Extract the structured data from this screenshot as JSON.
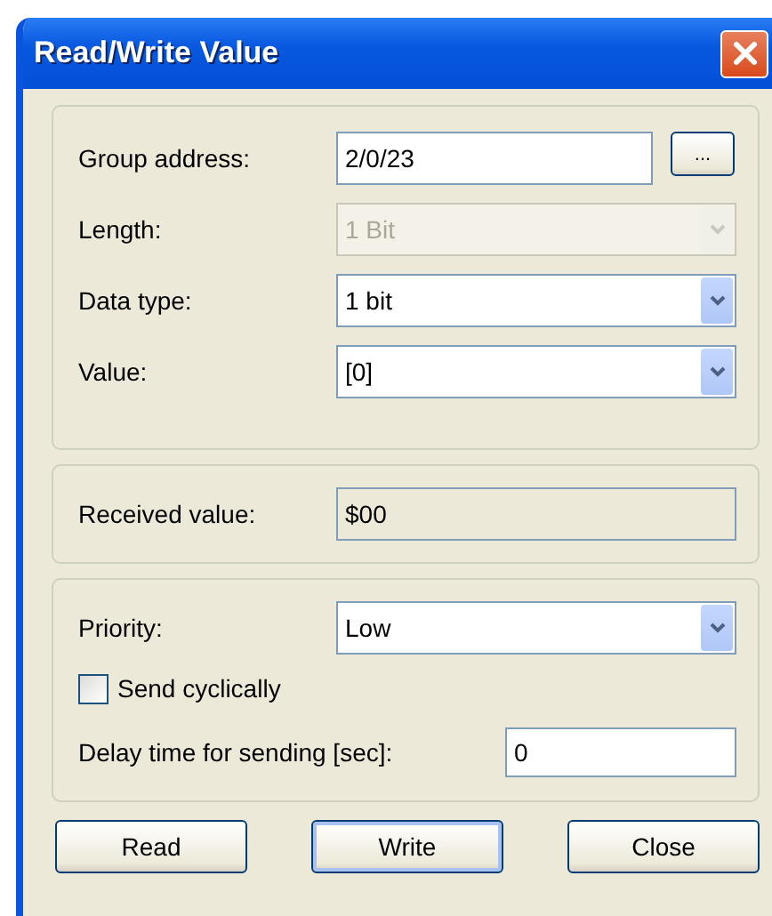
{
  "window": {
    "title": "Read/Write Value"
  },
  "groups": [
    {
      "rows": [
        {
          "kind": "text",
          "label": "Group address:",
          "value": "2/0/23",
          "button": "..."
        },
        {
          "kind": "combo",
          "label": "Length:",
          "value": "1 Bit",
          "disabled": true
        },
        {
          "kind": "combo",
          "label": "Data type:",
          "value": "1 bit",
          "disabled": false
        },
        {
          "kind": "combo",
          "label": "Value:",
          "value": "[0]",
          "disabled": false
        }
      ]
    },
    {
      "rows": [
        {
          "kind": "readonly",
          "label": "Received value:",
          "value": "$00"
        }
      ]
    },
    {
      "rows": [
        {
          "kind": "combo",
          "label": "Priority:",
          "value": "Low",
          "disabled": false
        },
        {
          "kind": "check",
          "label": "Send cyclically",
          "checked": false
        },
        {
          "kind": "short",
          "label": "Delay time for sending [sec]:",
          "value": "0"
        }
      ]
    }
  ],
  "buttons": [
    {
      "label": "Read",
      "default": false
    },
    {
      "label": "Write",
      "default": true
    },
    {
      "label": "Close",
      "default": false
    }
  ]
}
